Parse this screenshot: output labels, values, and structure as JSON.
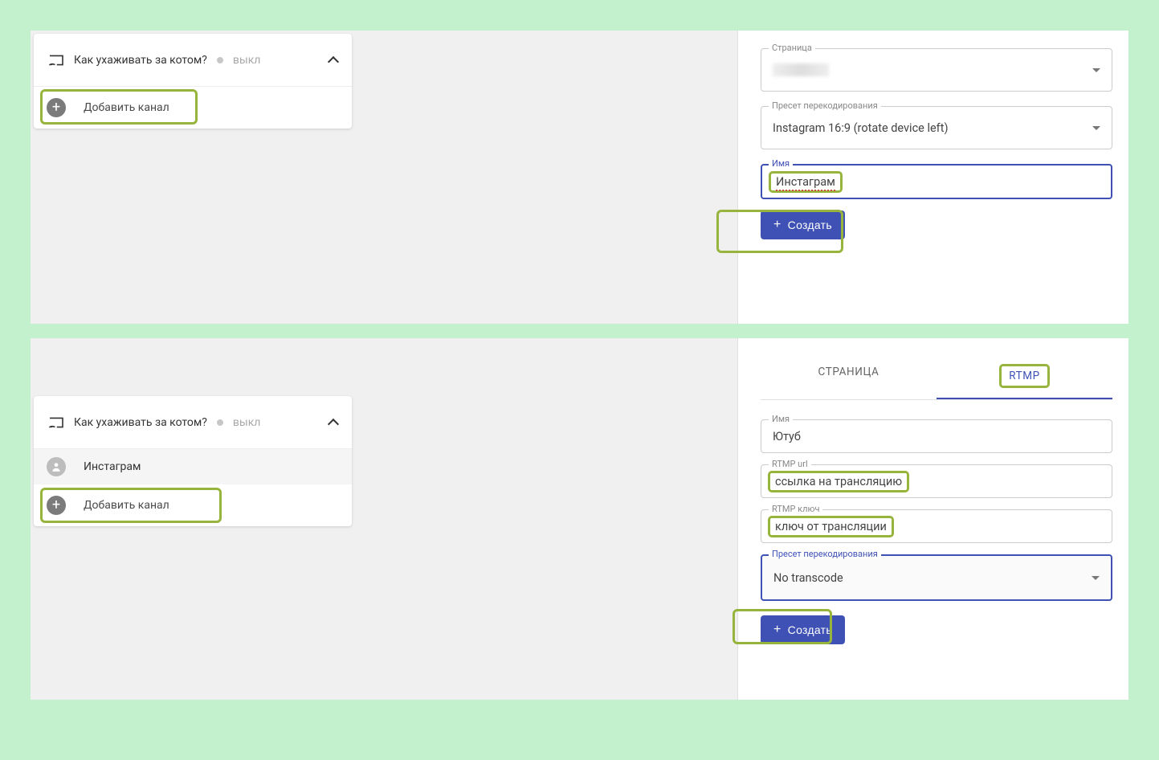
{
  "step1": {
    "card": {
      "title": "Как ухаживать за котом?",
      "status": "выкл"
    },
    "add_channel_label": "Добавить канал",
    "form": {
      "page_label": "Страница",
      "preset_label": "Пресет перекодирования",
      "preset_value": "Instagram 16:9 (rotate device left)",
      "name_label": "Имя",
      "name_value": "Инстаграм",
      "create_label": "Создать"
    }
  },
  "step2": {
    "card": {
      "title": "Как ухаживать за котом?",
      "status": "выкл"
    },
    "channel_name": "Инстаграм",
    "add_channel_label": "Добавить канал",
    "tabs": {
      "page": "СТРАНИЦА",
      "rtmp": "RTMP"
    },
    "form": {
      "name_label": "Имя",
      "name_value": "Ютуб",
      "rtmp_url_label": "RTMP url",
      "rtmp_url_value": "ссылка на трансляцию",
      "rtmp_key_label": "RTMP ключ",
      "rtmp_key_value": "ключ от трансляции",
      "preset_label": "Пресет перекодирования",
      "preset_value": "No transcode",
      "create_label": "Создать"
    }
  }
}
